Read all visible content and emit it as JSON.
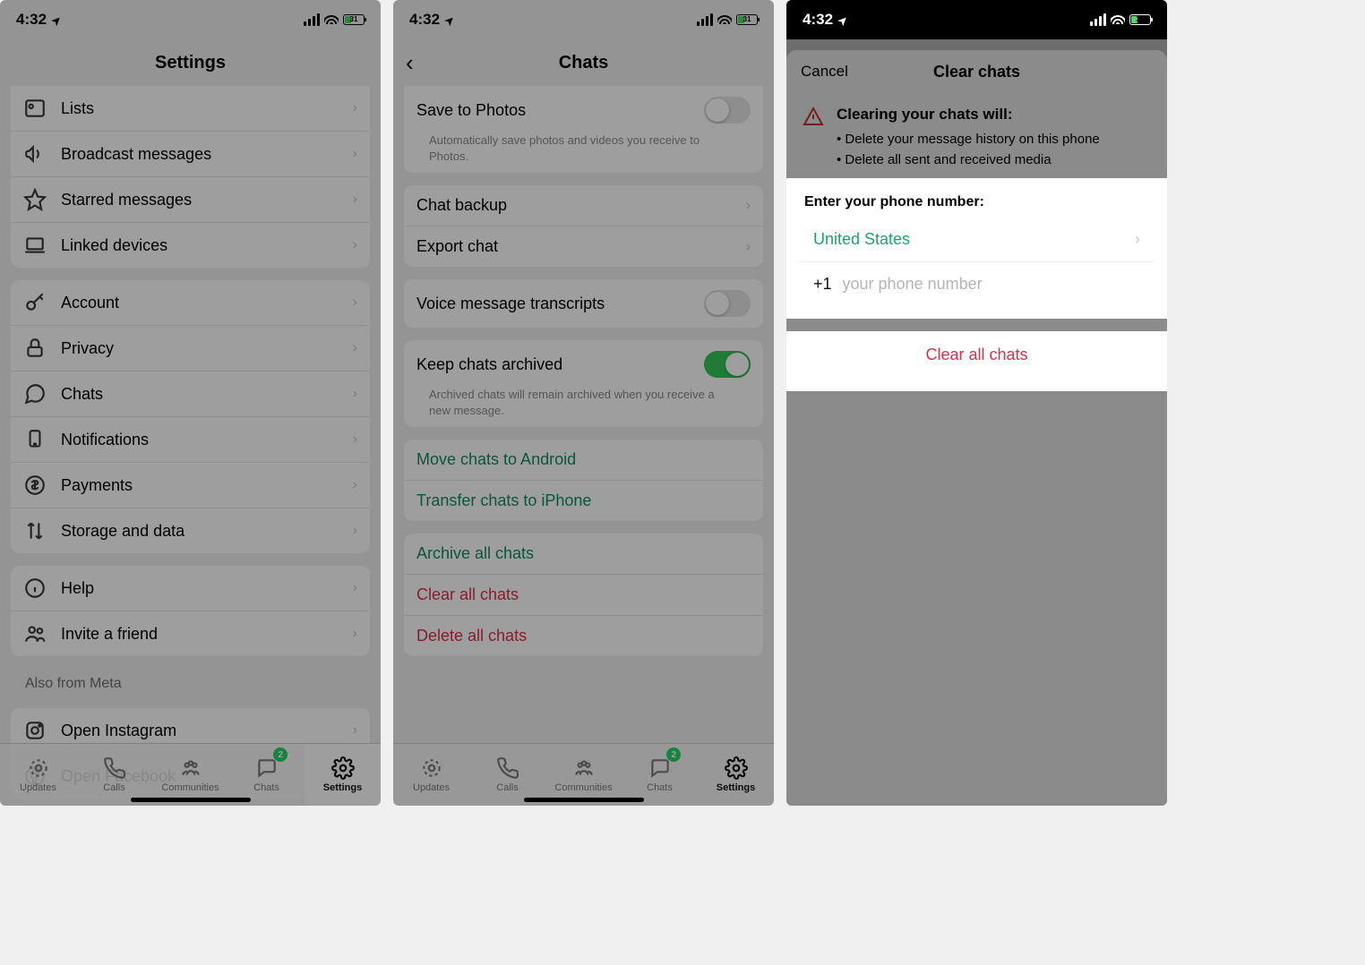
{
  "status": {
    "time": "4:32",
    "battery": "31"
  },
  "screen1": {
    "title": "Settings",
    "rows_top": [
      {
        "icon": "list-icon",
        "label": "Lists"
      },
      {
        "icon": "megaphone-icon",
        "label": "Broadcast messages"
      },
      {
        "icon": "star-icon",
        "label": "Starred messages"
      },
      {
        "icon": "laptop-icon",
        "label": "Linked devices"
      }
    ],
    "rows_acct": [
      {
        "icon": "key-icon",
        "label": "Account"
      },
      {
        "icon": "lock-icon",
        "label": "Privacy"
      },
      {
        "icon": "chat-icon",
        "label": "Chats",
        "highlight": true
      },
      {
        "icon": "bell-icon",
        "label": "Notifications"
      },
      {
        "icon": "dollar-icon",
        "label": "Payments"
      },
      {
        "icon": "arrows-icon",
        "label": "Storage and data"
      }
    ],
    "rows_help": [
      {
        "icon": "info-icon",
        "label": "Help"
      },
      {
        "icon": "people-icon",
        "label": "Invite a friend"
      }
    ],
    "meta_header": "Also from Meta",
    "rows_meta": [
      {
        "icon": "instagram-icon",
        "label": "Open Instagram"
      },
      {
        "icon": "facebook-icon",
        "label": "Open Facebook"
      }
    ]
  },
  "tabbar": {
    "items": [
      {
        "label": "Updates"
      },
      {
        "label": "Calls"
      },
      {
        "label": "Communities"
      },
      {
        "label": "Chats",
        "badge": "2"
      },
      {
        "label": "Settings"
      }
    ]
  },
  "screen2": {
    "title": "Chats",
    "save_title": "Save to Photos",
    "save_desc": "Automatically save photos and videos you receive to Photos.",
    "backup": "Chat backup",
    "export": "Export chat",
    "voice": "Voice message transcripts",
    "archive_title": "Keep chats archived",
    "archive_desc": "Archived chats will remain archived when you receive a new message.",
    "move_android": "Move chats to Android",
    "transfer_iphone": "Transfer chats to iPhone",
    "archive_all": "Archive all chats",
    "clear_all": "Clear all chats",
    "delete_all": "Delete all chats"
  },
  "screen3": {
    "cancel": "Cancel",
    "title": "Clear chats",
    "warn_title": "Clearing your chats will:",
    "warn1": "Delete your message history on this phone",
    "warn2": "Delete all sent and received media",
    "enter_hdr": "Enter your phone number:",
    "country": "United States",
    "cc": "+1",
    "ph_placeholder": "your phone number",
    "button": "Clear all chats"
  }
}
